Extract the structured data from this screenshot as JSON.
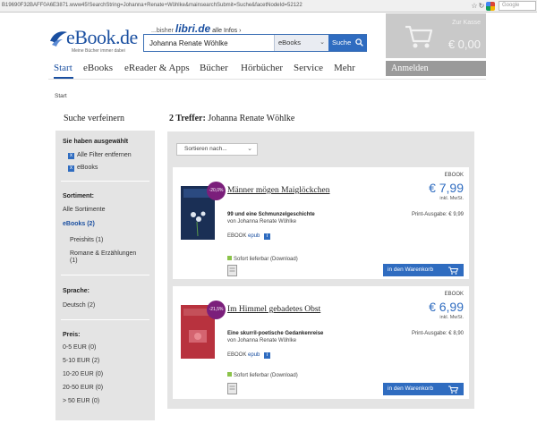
{
  "browser": {
    "url": "B19690F32BAFF0A6E3871.www45!SearchString=Johanna+Renate+Wöhlke&mainsearchSubmit=Suche&facetNodeId=52122",
    "search_engine_name": "Google"
  },
  "header": {
    "logo_text": "eBook.de",
    "logo_tagline": "Meine Bücher immer dabei",
    "previously": "...bisher",
    "previous_brand": "libri.de",
    "all_infos": "alle Infos ›",
    "search": {
      "value": "Johanna Renate Wöhlke",
      "category": "eBooks",
      "button": "Suche"
    },
    "cart": {
      "label": "Zur Kasse",
      "total": "€ 0,00"
    }
  },
  "nav": {
    "items": [
      "Start",
      "eBooks",
      "eReader & Apps",
      "Bücher",
      "Hörbücher",
      "Service",
      "Mehr"
    ],
    "active": "Start",
    "login": "Anmelden"
  },
  "breadcrumb": "Start",
  "sidebar": {
    "title": "Suche verfeinern",
    "selected_heading": "Sie haben ausgewählt",
    "selected": [
      "Alle Filter entfernen",
      "eBooks"
    ],
    "assortment_heading": "Sortiment:",
    "all_assortments": "Alle Sortimente",
    "ebooks_filter": "eBooks  (2)",
    "sub_filters": [
      "Preishits  (1)",
      "Romane & Erzählungen",
      "(1)"
    ],
    "language_heading": "Sprache:",
    "languages": [
      "Deutsch  (2)"
    ],
    "price_heading": "Preis:",
    "prices": [
      "0-5 EUR (0)",
      "5-10 EUR  (2)",
      "10-20 EUR (0)",
      "20-50 EUR (0)",
      "> 50 EUR (0)"
    ]
  },
  "results": {
    "count_label": "2 Treffer:",
    "query": "Johanna Renate Wöhlke",
    "sort_placeholder": "Sortieren nach...",
    "items": [
      {
        "title": "Männer mögen Maiglöckchen",
        "subtitle": "99 und eine Schmunzelgeschichte",
        "author": "von Johanna Renate Wöhlke",
        "format_line": "EBOOK",
        "format_sub": "epub",
        "availability": "Sofort lieferbar (Download)",
        "discount": "-20,0%",
        "format_label": "EBOOK",
        "price": "€ 7,99",
        "mwst": "inkl. MwSt.",
        "print_price": "Print-Ausgabe: € 9,99",
        "cart_button": "in den Warenkorb",
        "cover_color": "#1a2f55"
      },
      {
        "title": "Im Himmel gebadetes Obst",
        "subtitle": "Eine skurril-poetische Gedankenreise",
        "author": "von Johanna Renate Wöhlke",
        "format_line": "EBOOK",
        "format_sub": "epub",
        "availability": "Sofort lieferbar (Download)",
        "discount": "-21,5%",
        "format_label": "EBOOK",
        "price": "€ 6,99",
        "mwst": "inkl. MwSt.",
        "print_price": "Print-Ausgabe: € 8,90",
        "cart_button": "in den Warenkorb",
        "cover_color": "#b8323e"
      }
    ]
  },
  "colors": {
    "brand_blue": "#2f6cc0",
    "discount_purple": "#7b1f7b",
    "panel_gray": "#e4e4e4"
  }
}
